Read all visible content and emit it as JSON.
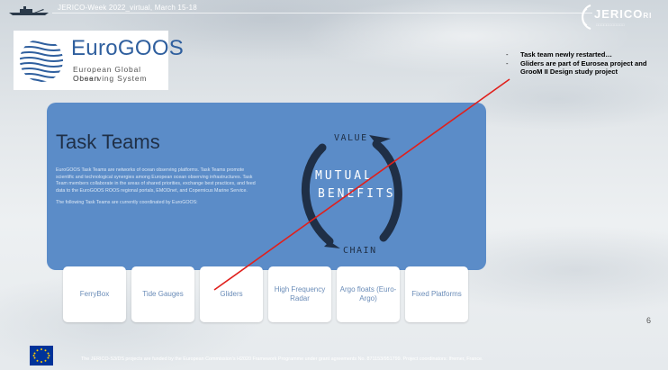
{
  "header": {
    "event_title": "JERICO-Week 2022_virtual, March 15-18",
    "jerico_logo_text": "JERICO",
    "jerico_logo_suffix": "RI",
    "jerico_logo_sub": "□□□□□□□□□□□"
  },
  "eurogoos": {
    "name": "EuroGOOS",
    "line1": "European Global Ocean",
    "line2": "Observing System",
    "brand_color": "#2f5f9e"
  },
  "notes": [
    "Task team newly restarted…",
    "Gliders are part of Eurosea project and GrooM II Design study project"
  ],
  "panel": {
    "title": "Task Teams",
    "paragraph1": "EuroGOOS Task Teams are networks of ocean observing platforms. Task Teams promote scientific and technological synergies among European ocean observing infrastructures. Task Team members collaborate in the areas of shared priorities, exchange best practices, and feed data to the EuroGOOS ROOS regional portals, EMODnet, and Copernicus Marine Service.",
    "paragraph2": "The following Task Teams are currently coordinated by EuroGOOS:",
    "cycle": {
      "top": "VALUE",
      "bottom": "CHAIN",
      "center1": "MUTUAL",
      "center2": "BENEFITS"
    },
    "panel_color": "#5b8cc8"
  },
  "cards": [
    {
      "label": "FerryBox"
    },
    {
      "label": "Tide Gauges"
    },
    {
      "label": "Gliders"
    },
    {
      "label": "High Frequency Radar"
    },
    {
      "label": "Argo floats (Euro-Argo)"
    },
    {
      "label": "Fixed Platforms"
    }
  ],
  "slide_number": "6",
  "footer": {
    "text": "The JERICO-S3/DS projects are funded by the European Commission’s H2020 Framework Programme under grant agreements No. 871153/951799. Project coordinators: Ifremer, France."
  },
  "annotation_color": "#e0201c"
}
